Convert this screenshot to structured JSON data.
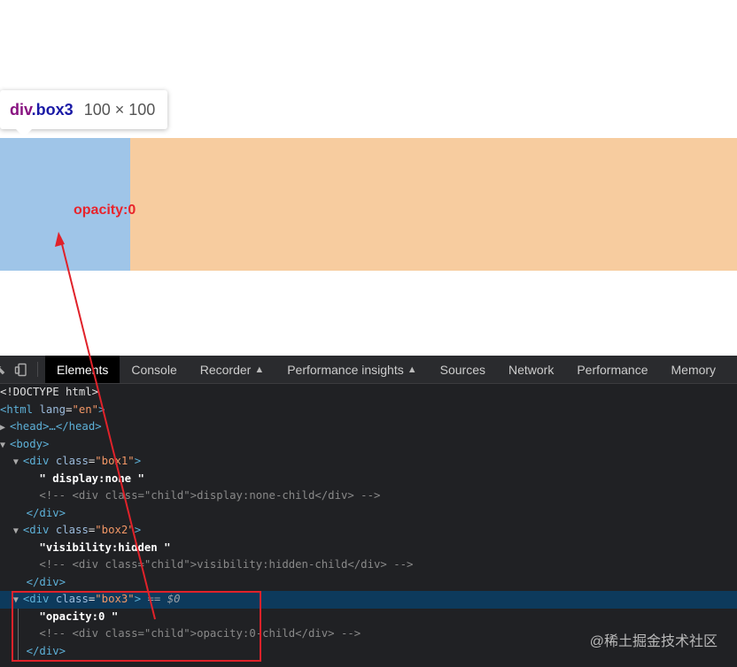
{
  "page": {
    "tooltip": {
      "tag": "div",
      "class_name": ".box3",
      "size": "100 × 100"
    },
    "annotation": "opacity:0"
  },
  "devtools": {
    "tabs": [
      "Elements",
      "Console",
      "Recorder",
      "Performance insights",
      "Sources",
      "Network",
      "Performance",
      "Memory"
    ],
    "active_tab": "Elements",
    "dom": {
      "doctype": "<!DOCTYPE html>",
      "html_open": "<html",
      "lang_attr": "lang",
      "lang_val": "\"en\"",
      "tag_close": ">",
      "head": "<head>…</head>",
      "body": "<body>",
      "div_open": "<div",
      "class_attr": "class",
      "div_close": "</div>",
      "box1_val": "\"box1\"",
      "box2_val": "\"box2\"",
      "box3_val": "\"box3\"",
      "box1_text": "\" display:none \"",
      "box2_text": "\"visibility:hidden \"",
      "box3_text": "\"opacity:0 \"",
      "box1_comment": "<!-- <div class=\"child\">display:none-child</div> -->",
      "box2_comment": "<!-- <div class=\"child\">visibility:hidden-child</div> -->",
      "box3_comment": "<!-- <div class=\"child\">opacity:0-child</div> -->",
      "eq": "==",
      "sel_ref": "$0"
    }
  },
  "watermark": "@稀土掘金技术社区",
  "colors": {
    "highlight_box": "#9fc5e8",
    "page_strip": "#f7cc9f",
    "annotation_red": "#e8242b",
    "devtools_bg": "#202124",
    "selected_row": "#0d3a5c"
  }
}
